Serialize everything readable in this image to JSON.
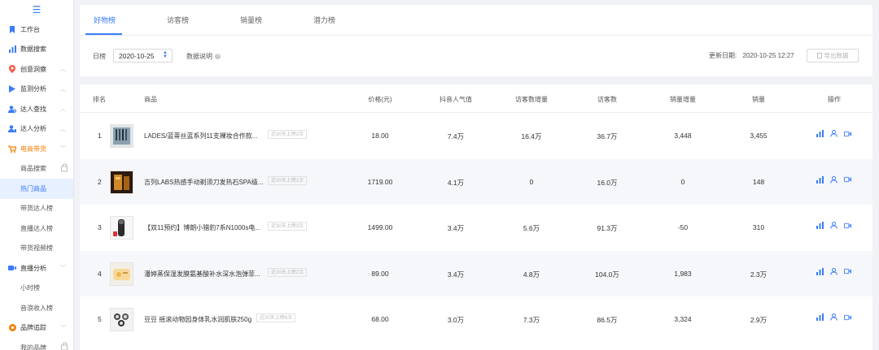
{
  "sidebar": {
    "toggle_icon": "menu-icon",
    "items": [
      {
        "label": "工作台",
        "icon": "bookmark-icon",
        "color": "#3b7cf6"
      },
      {
        "label": "数据搜索",
        "icon": "bar-chart-icon",
        "color": "#3b7cf6"
      },
      {
        "label": "创意洞察",
        "icon": "location-pin-icon",
        "color": "#f05c4b",
        "arrow": "^"
      },
      {
        "label": "监测分析",
        "icon": "play-icon",
        "color": "#3b7cf6",
        "arrow": "^"
      },
      {
        "label": "达人查找",
        "icon": "user-search-icon",
        "color": "#3b7cf6",
        "arrow": "^"
      },
      {
        "label": "达人分析",
        "icon": "user-analysis-icon",
        "color": "#3b7cf6",
        "arrow": "^"
      },
      {
        "label": "电商带货",
        "icon": "cart-icon",
        "color": "#f57c00",
        "arrow": "v"
      },
      {
        "label": "商品搜索",
        "sub": true,
        "lock": true
      },
      {
        "label": "热门商品",
        "sub": true,
        "active": true
      },
      {
        "label": "带货达人榜",
        "sub": true
      },
      {
        "label": "直播达人榜",
        "sub": true
      },
      {
        "label": "带货视频榜",
        "sub": true
      },
      {
        "label": "直播分析",
        "icon": "video-icon",
        "color": "#3b7cf6",
        "arrow": "v"
      },
      {
        "label": "小时榜",
        "sub": true
      },
      {
        "label": "音浪收入榜",
        "sub": true
      },
      {
        "label": "品牌追踪",
        "icon": "brand-icon",
        "color": "#f57c00",
        "arrow": "v"
      },
      {
        "label": "我的品牌",
        "sub": true,
        "lock": true
      }
    ]
  },
  "tabs": [
    "好物榜",
    "访客榜",
    "销量榜",
    "潜力榜"
  ],
  "filters": {
    "period_label": "日榜",
    "date_value": "2020-10-25",
    "data_desc_label": "数据说明",
    "help_glyph": "?",
    "update_label": "更新日期:",
    "update_value": "2020-10-25 12:27",
    "export_label": "导出数据"
  },
  "table": {
    "headers": {
      "rank": "排名",
      "product": "商品",
      "price": "价格(元)",
      "popularity": "抖音人气值",
      "visitor_increase": "访客数增量",
      "visitors": "访客数",
      "sales_increase": "销量增量",
      "sales": "销量",
      "actions": "操作"
    },
    "rows": [
      {
        "rank": "1",
        "name": "LADES/蓝蒂丝蓝系列11支裸妆合作款...",
        "badge": "近30天上榜2次",
        "price": "18.00",
        "popularity": "7.4万",
        "visitor_increase": "16.4万",
        "visitors": "36.7万",
        "sales_increase": "3,448",
        "sales": "3,455"
      },
      {
        "rank": "2",
        "name": "吉列LABS热感手动剃须刀发热石SPA级...",
        "badge": "近30天上榜1次",
        "price": "1719.00",
        "popularity": "4.1万",
        "visitor_increase": "0",
        "visitors": "16.0万",
        "sales_increase": "0",
        "sales": "148"
      },
      {
        "rank": "3",
        "name": "【双11预约】博朗小猎豹7系N1000s电...",
        "badge": "近30天上榜3次",
        "price": "1499.00",
        "popularity": "3.4万",
        "visitor_increase": "5.6万",
        "visitors": "91.3万",
        "sales_increase": "-50",
        "sales": "310"
      },
      {
        "rank": "4",
        "name": "潘婷蒸保湿发膜氨基酸补水深水泡弹菲...",
        "badge": "近30天上榜2次",
        "price": "89.00",
        "popularity": "3.4万",
        "visitor_increase": "4.8万",
        "visitors": "104.0万",
        "sales_increase": "1,983",
        "sales": "2.3万"
      },
      {
        "rank": "5",
        "name": "豆豆 摇滚动物园身体乳水润肌肤250g",
        "badge": "近30天上榜6次",
        "price": "68.00",
        "popularity": "3.0万",
        "visitor_increase": "7.3万",
        "visitors": "86.5万",
        "sales_increase": "3,324",
        "sales": "2.9万"
      }
    ],
    "action_icons": [
      "bar-chart-icon",
      "user-icon",
      "video-icon"
    ]
  },
  "colors": {
    "accent": "#3b7cf6",
    "orange": "#f57c00",
    "active_bg": "#e6f0ff"
  }
}
